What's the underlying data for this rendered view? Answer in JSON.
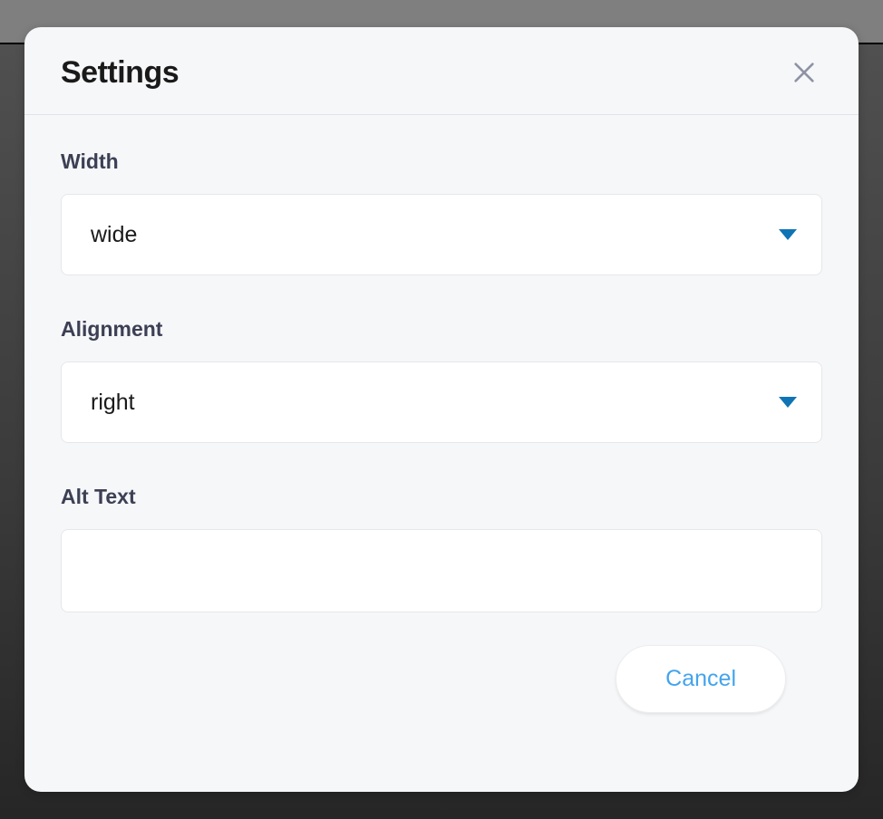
{
  "modal": {
    "title": "Settings",
    "fields": {
      "width": {
        "label": "Width",
        "value": "wide"
      },
      "alignment": {
        "label": "Alignment",
        "value": "right"
      },
      "alt_text": {
        "label": "Alt Text",
        "value": ""
      }
    },
    "footer": {
      "cancel_label": "Cancel"
    }
  }
}
